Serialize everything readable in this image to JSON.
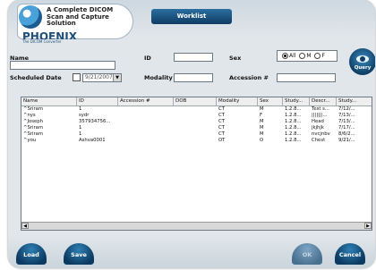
{
  "logo": {
    "tagline": "A Complete DICOM Scan and Capture Solution",
    "brand": "PHOENIX",
    "brand_sub": "The DICOM Converter"
  },
  "header": {
    "worklist_label": "Worklist"
  },
  "filters": {
    "name_label": "Name",
    "name_value": "",
    "id_label": "ID",
    "id_value": "",
    "sex_label": "Sex",
    "sex_options": [
      "All",
      "M",
      "F"
    ],
    "sex_selected": "All",
    "scheduled_date_label": "Scheduled Date",
    "scheduled_date_value": "9/21/2007",
    "modality_label": "Modality",
    "modality_value": "",
    "accession_label": "Accession #",
    "accession_value": "",
    "query_label": "Query"
  },
  "table": {
    "columns": [
      "Name",
      "ID",
      "Accession #",
      "DOB",
      "Modality",
      "Sex",
      "Study...",
      "Descr...",
      "Study..."
    ],
    "rows": [
      [
        "^Sriram",
        "1",
        "",
        "",
        "CT",
        "M",
        "1.2.8...",
        "Test s...",
        "7/12/..."
      ],
      [
        "^nys",
        "sydr",
        "",
        "",
        "CT",
        "F",
        "1.2.8...",
        "|||||||...",
        "7/13/..."
      ],
      [
        "^Joseph",
        "357934756...",
        "",
        "",
        "CT",
        "M",
        "1.2.8...",
        "Head",
        "7/13/..."
      ],
      [
        "^Sriram",
        "1",
        "",
        "",
        "CT",
        "M",
        "1.2.8...",
        "jkjhjk",
        "7/17/..."
      ],
      [
        "^Sriram",
        "1",
        "",
        "",
        "CT",
        "M",
        "1.2.8...",
        "nvcjnbv",
        "8/6/2..."
      ],
      [
        "^you",
        "Ashva0001",
        "",
        "",
        "OT",
        "O",
        "1.2.8...",
        "Chest",
        "9/21/..."
      ]
    ]
  },
  "buttons": {
    "load": "Load",
    "save": "Save",
    "ok": "OK",
    "cancel": "Cancel"
  },
  "colors": {
    "accent": "#0f3c63",
    "frame": "#e1e6ea"
  }
}
